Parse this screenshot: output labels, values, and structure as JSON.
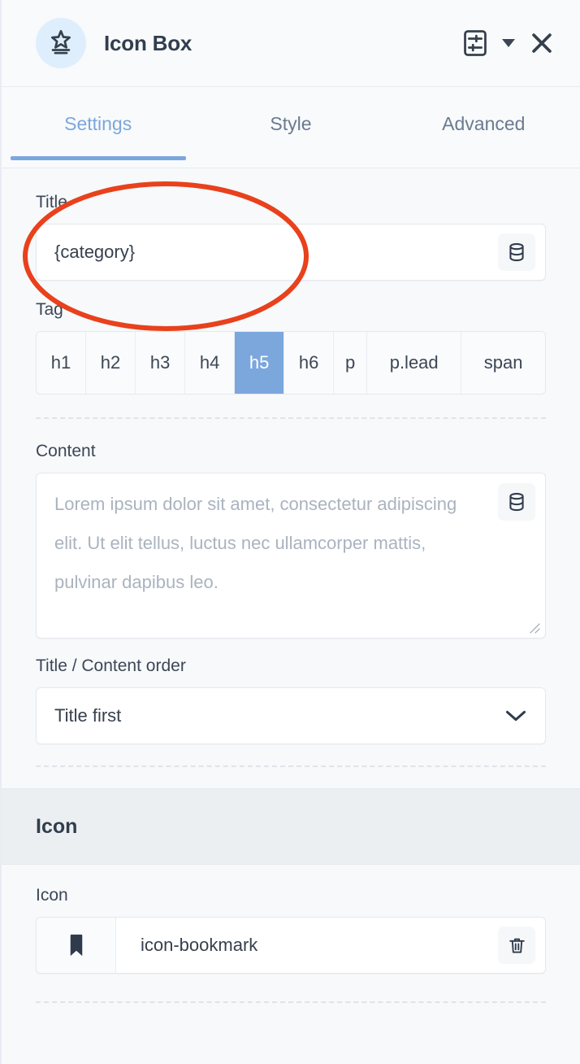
{
  "header": {
    "widget_icon": "star-lines-icon",
    "title": "Icon Box",
    "settings_icon": "sliders-panel-icon",
    "dropdown_icon": "caret-down-icon",
    "close_icon": "close-icon"
  },
  "tabs": [
    {
      "label": "Settings",
      "active": true
    },
    {
      "label": "Style",
      "active": false
    },
    {
      "label": "Advanced",
      "active": false
    }
  ],
  "fields": {
    "title": {
      "label": "Title",
      "value": "{category}",
      "placeholder": "",
      "dynamic_icon": "database-icon"
    },
    "tag": {
      "label": "Tag",
      "options": [
        "h1",
        "h2",
        "h3",
        "h4",
        "h5",
        "h6",
        "p",
        "p.lead",
        "span"
      ],
      "selected": "h5"
    },
    "content": {
      "label": "Content",
      "value": "",
      "placeholder": "Lorem ipsum dolor sit amet, consectetur adipiscing elit. Ut elit tellus, luctus nec ullamcorper mattis, pulvinar dapibus leo.",
      "dynamic_icon": "database-icon",
      "resize_icon": "resize-grip-icon"
    },
    "order": {
      "label": "Title / Content order",
      "value": "Title first",
      "caret_icon": "chevron-down-icon"
    }
  },
  "icon_section": {
    "band_title": "Icon",
    "field_label": "Icon",
    "preview_icon": "bookmark-icon",
    "value": "icon-bookmark",
    "delete_icon": "trash-icon"
  },
  "colors": {
    "accent": "#7ba7dd",
    "text": "#36404d",
    "muted": "#6b7a90",
    "panel_bg": "#f7f9fb",
    "section_band_bg": "#eceff1",
    "badge_bg": "#dfeefc",
    "annotation": "#e8411c"
  },
  "annotation": {
    "shape": "ellipse",
    "color": "#e8411c",
    "target": "Title field"
  }
}
